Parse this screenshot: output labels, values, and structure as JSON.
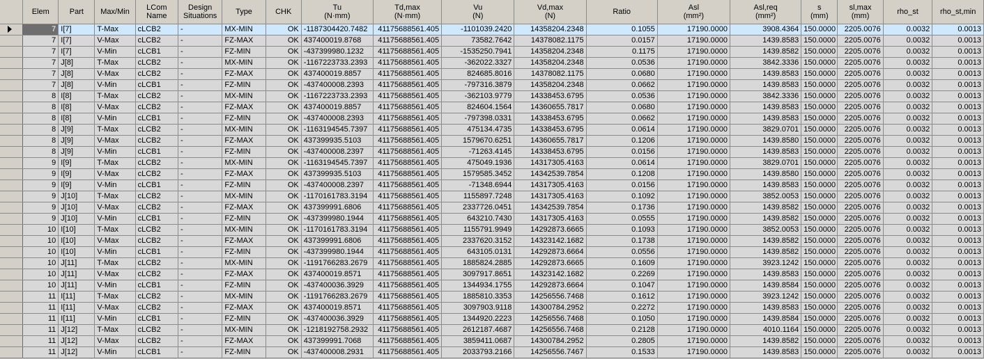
{
  "columns": [
    {
      "key": "rowhdr",
      "label": ""
    },
    {
      "key": "elem",
      "label": "Elem"
    },
    {
      "key": "part",
      "label": "Part"
    },
    {
      "key": "maxmin",
      "label": "Max/Min"
    },
    {
      "key": "lcom",
      "label": "LCom\nName"
    },
    {
      "key": "design",
      "label": "Design\nSituations"
    },
    {
      "key": "type",
      "label": "Type"
    },
    {
      "key": "chk",
      "label": "CHK"
    },
    {
      "key": "tu",
      "label": "Tu\n(N·mm)"
    },
    {
      "key": "tdmax",
      "label": "Td,max\n(N·mm)"
    },
    {
      "key": "vu",
      "label": "Vu\n(N)"
    },
    {
      "key": "vdmax",
      "label": "Vd,max\n(N)"
    },
    {
      "key": "ratio",
      "label": "Ratio"
    },
    {
      "key": "asl",
      "label": "Asl\n(mm²)"
    },
    {
      "key": "aslreq",
      "label": "Asl,req\n(mm²)"
    },
    {
      "key": "s",
      "label": "s\n(mm)"
    },
    {
      "key": "slmax",
      "label": "sl,max\n(mm)"
    },
    {
      "key": "rhost",
      "label": "rho_st"
    },
    {
      "key": "rhostmin",
      "label": "rho_st,min"
    }
  ],
  "selected_row": 0,
  "rows": [
    [
      "7",
      "I[7]",
      "T-Max",
      "cLCB2",
      "-",
      "MX-MIN",
      "OK",
      "-1187304420.7482",
      "41175688561.405",
      "-1101039.2420",
      "14358204.2348",
      "0.1055",
      "17190.0000",
      "3908.4364",
      "150.0000",
      "2205.0076",
      "0.0032",
      "0.0013"
    ],
    [
      "7",
      "I[7]",
      "V-Max",
      "cLCB2",
      "-",
      "FZ-MAX",
      "OK",
      "437400019.8768",
      "41175688561.405",
      "73582.7642",
      "14378082.1175",
      "0.0157",
      "17190.0000",
      "1439.8583",
      "150.0000",
      "2205.0076",
      "0.0032",
      "0.0013"
    ],
    [
      "7",
      "I[7]",
      "V-Min",
      "cLCB1",
      "-",
      "FZ-MIN",
      "OK",
      "-437399980.1232",
      "41175688561.405",
      "-1535250.7941",
      "14358204.2348",
      "0.1175",
      "17190.0000",
      "1439.8582",
      "150.0000",
      "2205.0076",
      "0.0032",
      "0.0013"
    ],
    [
      "7",
      "J[8]",
      "T-Max",
      "cLCB2",
      "-",
      "MX-MIN",
      "OK",
      "-1167223733.2393",
      "41175688561.405",
      "-362022.3327",
      "14358204.2348",
      "0.0536",
      "17190.0000",
      "3842.3336",
      "150.0000",
      "2205.0076",
      "0.0032",
      "0.0013"
    ],
    [
      "7",
      "J[8]",
      "V-Max",
      "cLCB2",
      "-",
      "FZ-MAX",
      "OK",
      "437400019.8857",
      "41175688561.405",
      "824685.8016",
      "14378082.1175",
      "0.0680",
      "17190.0000",
      "1439.8583",
      "150.0000",
      "2205.0076",
      "0.0032",
      "0.0013"
    ],
    [
      "7",
      "J[8]",
      "V-Min",
      "cLCB1",
      "-",
      "FZ-MIN",
      "OK",
      "-437400008.2393",
      "41175688561.405",
      "-797316.3879",
      "14358204.2348",
      "0.0662",
      "17190.0000",
      "1439.8583",
      "150.0000",
      "2205.0076",
      "0.0032",
      "0.0013"
    ],
    [
      "8",
      "I[8]",
      "T-Max",
      "cLCB2",
      "-",
      "MX-MIN",
      "OK",
      "-1167223733.2393",
      "41175688561.405",
      "-362103.9779",
      "14338453.6795",
      "0.0536",
      "17190.0000",
      "3842.3336",
      "150.0000",
      "2205.0076",
      "0.0032",
      "0.0013"
    ],
    [
      "8",
      "I[8]",
      "V-Max",
      "cLCB2",
      "-",
      "FZ-MAX",
      "OK",
      "437400019.8857",
      "41175688561.405",
      "824604.1564",
      "14360655.7817",
      "0.0680",
      "17190.0000",
      "1439.8583",
      "150.0000",
      "2205.0076",
      "0.0032",
      "0.0013"
    ],
    [
      "8",
      "I[8]",
      "V-Min",
      "cLCB1",
      "-",
      "FZ-MIN",
      "OK",
      "-437400008.2393",
      "41175688561.405",
      "-797398.0331",
      "14338453.6795",
      "0.0662",
      "17190.0000",
      "1439.8583",
      "150.0000",
      "2205.0076",
      "0.0032",
      "0.0013"
    ],
    [
      "8",
      "J[9]",
      "T-Max",
      "cLCB2",
      "-",
      "MX-MIN",
      "OK",
      "-1163194545.7397",
      "41175688561.405",
      "475134.4735",
      "14338453.6795",
      "0.0614",
      "17190.0000",
      "3829.0701",
      "150.0000",
      "2205.0076",
      "0.0032",
      "0.0013"
    ],
    [
      "8",
      "J[9]",
      "V-Max",
      "cLCB2",
      "-",
      "FZ-MAX",
      "OK",
      "437399935.5103",
      "41175688561.405",
      "1579670.6251",
      "14360655.7817",
      "0.1206",
      "17190.0000",
      "1439.8580",
      "150.0000",
      "2205.0076",
      "0.0032",
      "0.0013"
    ],
    [
      "8",
      "J[9]",
      "V-Min",
      "cLCB1",
      "-",
      "FZ-MIN",
      "OK",
      "-437400008.2397",
      "41175688561.405",
      "-71263.4145",
      "14338453.6795",
      "0.0156",
      "17190.0000",
      "1439.8583",
      "150.0000",
      "2205.0076",
      "0.0032",
      "0.0013"
    ],
    [
      "9",
      "I[9]",
      "T-Max",
      "cLCB2",
      "-",
      "MX-MIN",
      "OK",
      "-1163194545.7397",
      "41175688561.405",
      "475049.1936",
      "14317305.4163",
      "0.0614",
      "17190.0000",
      "3829.0701",
      "150.0000",
      "2205.0076",
      "0.0032",
      "0.0013"
    ],
    [
      "9",
      "I[9]",
      "V-Max",
      "cLCB2",
      "-",
      "FZ-MAX",
      "OK",
      "437399935.5103",
      "41175688561.405",
      "1579585.3452",
      "14342539.7854",
      "0.1208",
      "17190.0000",
      "1439.8580",
      "150.0000",
      "2205.0076",
      "0.0032",
      "0.0013"
    ],
    [
      "9",
      "I[9]",
      "V-Min",
      "cLCB1",
      "-",
      "FZ-MIN",
      "OK",
      "-437400008.2397",
      "41175688561.405",
      "-71348.6944",
      "14317305.4163",
      "0.0156",
      "17190.0000",
      "1439.8583",
      "150.0000",
      "2205.0076",
      "0.0032",
      "0.0013"
    ],
    [
      "9",
      "J[10]",
      "T-Max",
      "cLCB2",
      "-",
      "MX-MIN",
      "OK",
      "-1170161783.3194",
      "41175688561.405",
      "1155897.7248",
      "14317305.4163",
      "0.1092",
      "17190.0000",
      "3852.0053",
      "150.0000",
      "2205.0076",
      "0.0032",
      "0.0013"
    ],
    [
      "9",
      "J[10]",
      "V-Max",
      "cLCB2",
      "-",
      "FZ-MAX",
      "OK",
      "437399991.6806",
      "41175688561.405",
      "2337726.0451",
      "14342539.7854",
      "0.1736",
      "17190.0000",
      "1439.8582",
      "150.0000",
      "2205.0076",
      "0.0032",
      "0.0013"
    ],
    [
      "9",
      "J[10]",
      "V-Min",
      "cLCB1",
      "-",
      "FZ-MIN",
      "OK",
      "-437399980.1944",
      "41175688561.405",
      "643210.7430",
      "14317305.4163",
      "0.0555",
      "17190.0000",
      "1439.8582",
      "150.0000",
      "2205.0076",
      "0.0032",
      "0.0013"
    ],
    [
      "10",
      "I[10]",
      "T-Max",
      "cLCB2",
      "-",
      "MX-MIN",
      "OK",
      "-1170161783.3194",
      "41175688561.405",
      "1155791.9949",
      "14292873.6665",
      "0.1093",
      "17190.0000",
      "3852.0053",
      "150.0000",
      "2205.0076",
      "0.0032",
      "0.0013"
    ],
    [
      "10",
      "I[10]",
      "V-Max",
      "cLCB2",
      "-",
      "FZ-MAX",
      "OK",
      "437399991.6806",
      "41175688561.405",
      "2337620.3152",
      "14323142.1682",
      "0.1738",
      "17190.0000",
      "1439.8582",
      "150.0000",
      "2205.0076",
      "0.0032",
      "0.0013"
    ],
    [
      "10",
      "I[10]",
      "V-Min",
      "cLCB1",
      "-",
      "FZ-MIN",
      "OK",
      "-437399980.1944",
      "41175688561.405",
      "643105.0131",
      "14292873.6664",
      "0.0556",
      "17190.0000",
      "1439.8582",
      "150.0000",
      "2205.0076",
      "0.0032",
      "0.0013"
    ],
    [
      "10",
      "J[11]",
      "T-Max",
      "cLCB2",
      "-",
      "MX-MIN",
      "OK",
      "-1191766283.2679",
      "41175688561.405",
      "1885824.2885",
      "14292873.6665",
      "0.1609",
      "17190.0000",
      "3923.1242",
      "150.0000",
      "2205.0076",
      "0.0032",
      "0.0013"
    ],
    [
      "10",
      "J[11]",
      "V-Max",
      "cLCB2",
      "-",
      "FZ-MAX",
      "OK",
      "437400019.8571",
      "41175688561.405",
      "3097917.8651",
      "14323142.1682",
      "0.2269",
      "17190.0000",
      "1439.8583",
      "150.0000",
      "2205.0076",
      "0.0032",
      "0.0013"
    ],
    [
      "10",
      "J[11]",
      "V-Min",
      "cLCB1",
      "-",
      "FZ-MIN",
      "OK",
      "-437400036.3929",
      "41175688561.405",
      "1344934.1755",
      "14292873.6664",
      "0.1047",
      "17190.0000",
      "1439.8584",
      "150.0000",
      "2205.0076",
      "0.0032",
      "0.0013"
    ],
    [
      "11",
      "I[11]",
      "T-Max",
      "cLCB2",
      "-",
      "MX-MIN",
      "OK",
      "-1191766283.2679",
      "41175688561.405",
      "1885810.3353",
      "14256556.7468",
      "0.1612",
      "17190.0000",
      "3923.1242",
      "150.0000",
      "2205.0076",
      "0.0032",
      "0.0013"
    ],
    [
      "11",
      "I[11]",
      "V-Max",
      "cLCB2",
      "-",
      "FZ-MAX",
      "OK",
      "437400019.8571",
      "41175688561.405",
      "3097903.9118",
      "14300784.2952",
      "0.2272",
      "17190.0000",
      "1439.8583",
      "150.0000",
      "2205.0076",
      "0.0032",
      "0.0013"
    ],
    [
      "11",
      "I[11]",
      "V-Min",
      "cLCB1",
      "-",
      "FZ-MIN",
      "OK",
      "-437400036.3929",
      "41175688561.405",
      "1344920.2223",
      "14256556.7468",
      "0.1050",
      "17190.0000",
      "1439.8584",
      "150.0000",
      "2205.0076",
      "0.0032",
      "0.0013"
    ],
    [
      "11",
      "J[12]",
      "T-Max",
      "cLCB2",
      "-",
      "MX-MIN",
      "OK",
      "-1218192758.2932",
      "41175688561.405",
      "2612187.4687",
      "14256556.7468",
      "0.2128",
      "17190.0000",
      "4010.1164",
      "150.0000",
      "2205.0076",
      "0.0032",
      "0.0013"
    ],
    [
      "11",
      "J[12]",
      "V-Max",
      "cLCB2",
      "-",
      "FZ-MAX",
      "OK",
      "437399991.7068",
      "41175688561.405",
      "3859411.0687",
      "14300784.2952",
      "0.2805",
      "17190.0000",
      "1439.8582",
      "150.0000",
      "2205.0076",
      "0.0032",
      "0.0013"
    ],
    [
      "11",
      "J[12]",
      "V-Min",
      "cLCB1",
      "-",
      "FZ-MIN",
      "OK",
      "-437400008.2931",
      "41175688561.405",
      "2033793.2166",
      "14256556.7467",
      "0.1533",
      "17190.0000",
      "1439.8583",
      "150.0000",
      "2205.0076",
      "0.0032",
      "0.0013"
    ]
  ]
}
